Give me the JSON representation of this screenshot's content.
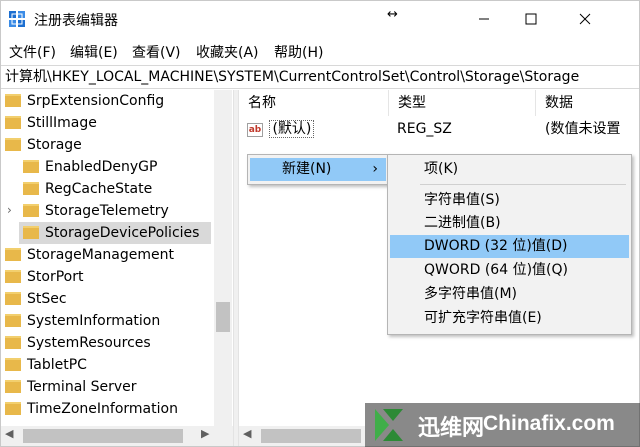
{
  "window": {
    "title": "注册表编辑器"
  },
  "menubar": [
    "文件(F)",
    "编辑(E)",
    "查看(V)",
    "收藏夹(A)",
    "帮助(H)"
  ],
  "address": "计算机\\HKEY_LOCAL_MACHINE\\SYSTEM\\CurrentControlSet\\Control\\Storage\\Storage",
  "tree": {
    "items": [
      "SrpExtensionConfig",
      "StillImage",
      "Storage",
      "EnabledDenyGP",
      "RegCacheState",
      "StorageTelemetry",
      "StorageDevicePolicies",
      "StorageManagement",
      "StorPort",
      "StSec",
      "SystemInformation",
      "SystemResources",
      "TabletPC",
      "Terminal Server",
      "TimeZoneInformation"
    ],
    "selected": "StorageDevicePolicies"
  },
  "list": {
    "columns": [
      "名称",
      "类型",
      "数据"
    ],
    "rows": [
      {
        "name": "(默认)",
        "type": "REG_SZ",
        "data": "(数值未设置"
      }
    ]
  },
  "context_menu": {
    "items": [
      "新建(N)"
    ],
    "submenu_arrow": "›"
  },
  "submenu": {
    "items": [
      "项(K)",
      "字符串值(S)",
      "二进制值(B)",
      "DWORD (32 位)值(D)",
      "QWORD (64 位)值(Q)",
      "多字符串值(M)",
      "可扩充字符串值(E)"
    ],
    "highlighted": "DWORD (32 位)值(D)"
  },
  "watermark": {
    "cn": "迅维网",
    "en": "Chinafix.com"
  },
  "colors": {
    "highlight": "#91c9f7",
    "folder": "#e8b84a",
    "selection": "#d9d9d9"
  }
}
